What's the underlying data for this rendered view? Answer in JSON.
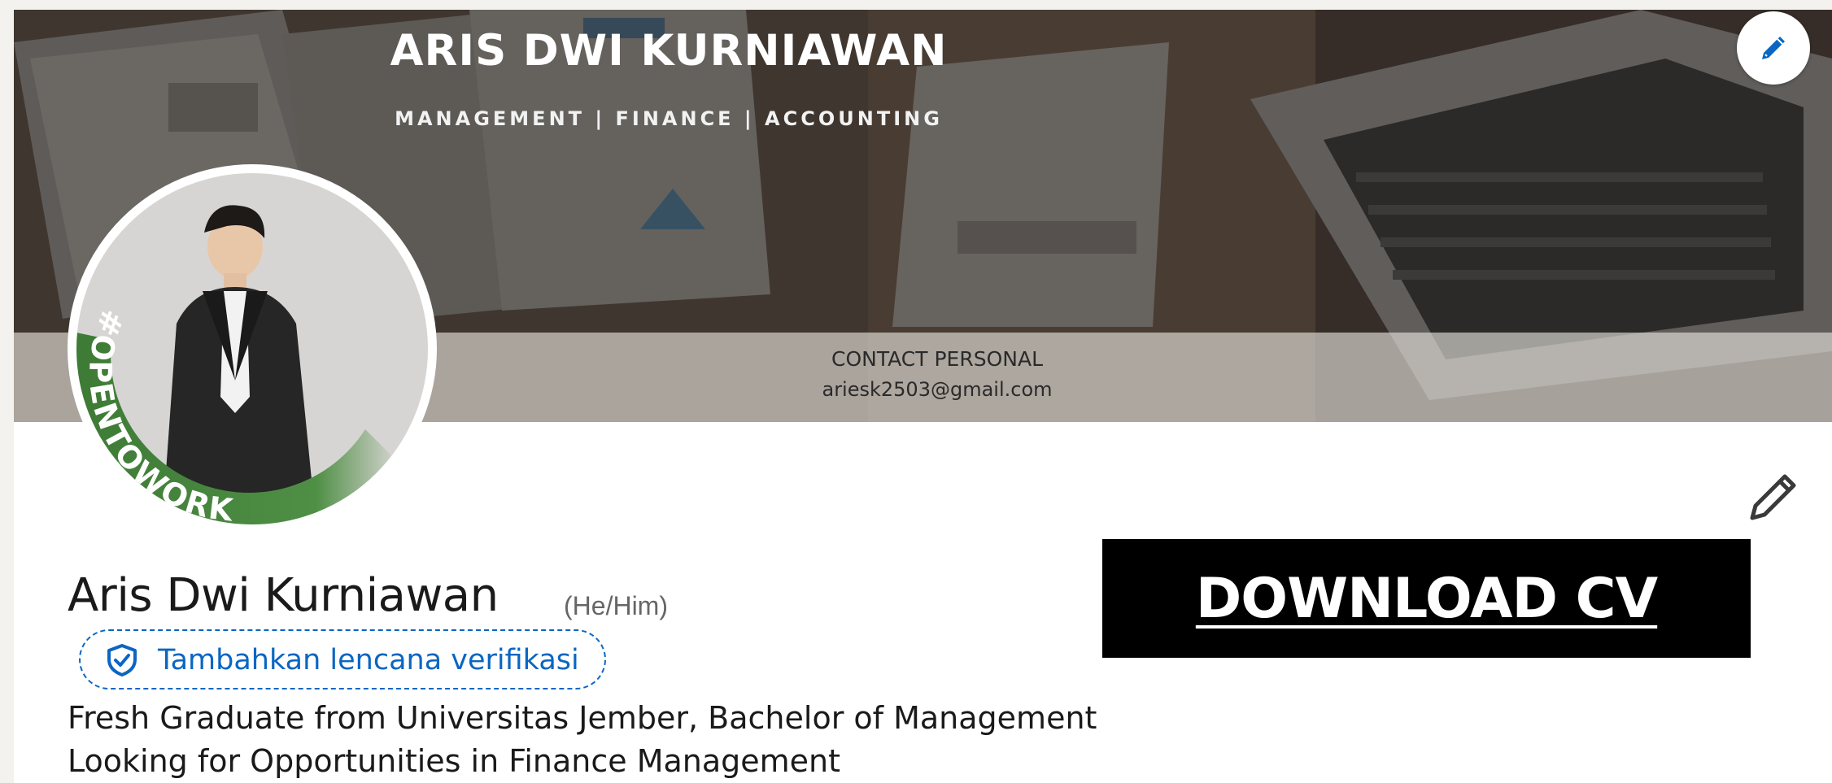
{
  "banner": {
    "title": "ARIS DWI KURNIAWAN",
    "subtitle": "MANAGEMENT | FINANCE | ACCOUNTING",
    "contact_label": "CONTACT PERSONAL",
    "contact_email": "ariesk2503@gmail.com",
    "edit_icon": "pencil-icon"
  },
  "avatar": {
    "frame_text": "#OPENTOWORK",
    "frame_color": "#3d7a35"
  },
  "profile": {
    "name": "Aris Dwi Kurniawan",
    "pronouns": "(He/Him)",
    "verify_label": "Tambahkan lencana verifikasi",
    "verify_icon": "shield-check-icon",
    "headline_1": "Fresh Graduate from Universitas Jember, Bachelor of Management",
    "headline_2": "Looking for Opportunities in Finance Management",
    "edit_icon": "pencil-icon"
  },
  "download_button": {
    "label": "DOWNLOAD CV"
  },
  "colors": {
    "link_blue": "#0a66c2",
    "button_black": "#000000",
    "opentowork_green": "#3d7a35"
  }
}
